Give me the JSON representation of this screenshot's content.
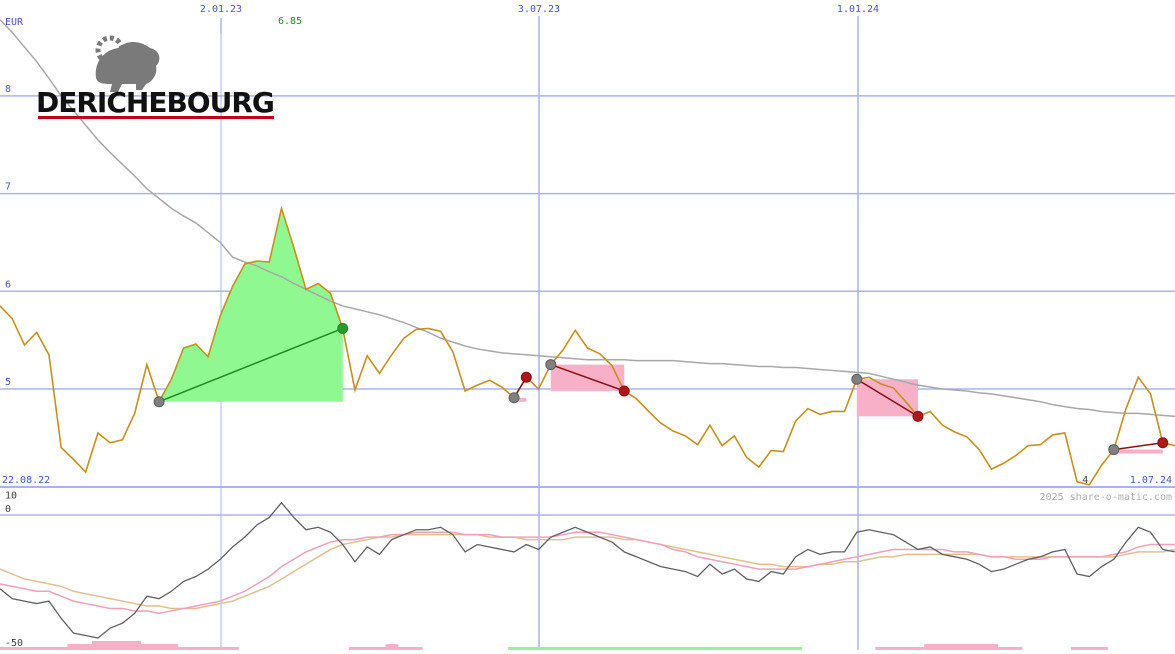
{
  "chart_data": {
    "type": "line",
    "company": "DERICHEBOURG",
    "currency": "EUR",
    "watermark": "2025 share-o-matic.com",
    "x_start_label": "22.08.22",
    "x_date_ticks": [
      "2.01.23",
      "3.07.23",
      "1.01.24"
    ],
    "x_end_label": "1.07.24",
    "y_ticks": [
      8,
      7,
      6,
      5
    ],
    "ylim": [
      3.95,
      9.0
    ],
    "max_label": "6.85",
    "min_label": "4",
    "price_series": [
      5.85,
      5.72,
      5.45,
      5.58,
      5.35,
      4.4,
      4.28,
      4.15,
      4.55,
      4.45,
      4.48,
      4.75,
      5.25,
      4.87,
      5.1,
      5.42,
      5.46,
      5.33,
      5.75,
      6.05,
      6.28,
      6.31,
      6.3,
      6.85,
      6.45,
      6.02,
      6.08,
      5.98,
      5.62,
      4.99,
      5.34,
      5.16,
      5.35,
      5.52,
      5.61,
      5.62,
      5.59,
      5.38,
      4.98,
      5.04,
      5.09,
      5.02,
      4.91,
      5.12,
      5.0,
      5.25,
      5.4,
      5.6,
      5.42,
      5.36,
      5.24,
      4.98,
      4.9,
      4.77,
      4.65,
      4.57,
      4.52,
      4.43,
      4.63,
      4.42,
      4.52,
      4.3,
      4.2,
      4.37,
      4.36,
      4.67,
      4.8,
      4.74,
      4.77,
      4.77,
      5.1,
      5.12,
      5.05,
      5.01,
      4.87,
      4.72,
      4.77,
      4.63,
      4.56,
      4.51,
      4.38,
      4.18,
      4.24,
      4.32,
      4.42,
      4.43,
      4.53,
      4.55,
      4.05,
      4.02,
      4.22,
      4.38,
      4.8,
      5.12,
      4.95,
      4.45,
      4.42
    ],
    "moving_average": [
      8.78,
      8.65,
      8.5,
      8.35,
      8.18,
      8.0,
      7.85,
      7.7,
      7.55,
      7.42,
      7.3,
      7.18,
      7.05,
      6.95,
      6.85,
      6.77,
      6.7,
      6.6,
      6.5,
      6.35,
      6.3,
      6.26,
      6.2,
      6.15,
      6.08,
      6.02,
      5.96,
      5.9,
      5.85,
      5.82,
      5.79,
      5.76,
      5.72,
      5.68,
      5.63,
      5.58,
      5.52,
      5.48,
      5.44,
      5.41,
      5.39,
      5.37,
      5.36,
      5.35,
      5.34,
      5.33,
      5.32,
      5.31,
      5.3,
      5.3,
      5.3,
      5.3,
      5.29,
      5.29,
      5.29,
      5.29,
      5.28,
      5.27,
      5.26,
      5.26,
      5.25,
      5.24,
      5.23,
      5.23,
      5.22,
      5.22,
      5.21,
      5.2,
      5.19,
      5.18,
      5.17,
      5.16,
      5.13,
      5.1,
      5.07,
      5.04,
      5.02,
      5.0,
      4.99,
      4.98,
      4.96,
      4.95,
      4.93,
      4.91,
      4.89,
      4.87,
      4.84,
      4.82,
      4.8,
      4.79,
      4.77,
      4.76,
      4.75,
      4.75,
      4.74,
      4.73,
      4.72
    ],
    "signals": [
      {
        "type": "buy",
        "from": 13,
        "to": 28
      },
      {
        "type": "sell",
        "from": 42,
        "to": 43
      },
      {
        "type": "sell",
        "from": 45,
        "to": 51
      },
      {
        "type": "sell",
        "from": 70,
        "to": 75
      },
      {
        "type": "sell",
        "from": 91,
        "to": 95
      }
    ],
    "oscillator": {
      "ylim": [
        -50,
        10
      ],
      "y_ticks": [
        10,
        0,
        -50
      ],
      "fast": [
        -30,
        -34,
        -35,
        -36,
        -35,
        -42,
        -48,
        -49,
        -50,
        -46,
        -44,
        -40,
        -33,
        -34,
        -31,
        -27,
        -25,
        -22,
        -18,
        -13,
        -9,
        -4,
        -1,
        5,
        -1,
        -6,
        -5,
        -7,
        -12,
        -19,
        -13,
        -16,
        -10,
        -8,
        -6,
        -6,
        -5,
        -8,
        -15,
        -12,
        -13,
        -14,
        -15,
        -12,
        -14,
        -9,
        -7,
        -5,
        -7,
        -9,
        -11,
        -15,
        -17,
        -19,
        -21,
        -22,
        -23,
        -25,
        -20,
        -24,
        -22,
        -26,
        -27,
        -23,
        -24,
        -17,
        -14,
        -16,
        -15,
        -15,
        -7,
        -6,
        -7,
        -8,
        -11,
        -14,
        -13,
        -16,
        -17,
        -18,
        -20,
        -23,
        -22,
        -20,
        -18,
        -17,
        -15,
        -14,
        -24,
        -25,
        -21,
        -18,
        -11,
        -5,
        -7,
        -14,
        -15
      ],
      "slow": [
        -28,
        -29,
        -30,
        -31,
        -31,
        -33,
        -35,
        -36,
        -37,
        -38,
        -38,
        -39,
        -39,
        -40,
        -39,
        -38,
        -37,
        -36,
        -35,
        -33,
        -31,
        -28,
        -25,
        -21,
        -18,
        -15,
        -13,
        -11,
        -10,
        -10,
        -9,
        -9,
        -8,
        -8,
        -7,
        -7,
        -7,
        -7,
        -8,
        -8,
        -8,
        -9,
        -9,
        -9,
        -9,
        -9,
        -8,
        -7,
        -7,
        -7,
        -8,
        -9,
        -10,
        -11,
        -12,
        -14,
        -15,
        -17,
        -18,
        -19,
        -20,
        -21,
        -22,
        -22,
        -22,
        -22,
        -21,
        -20,
        -19,
        -18,
        -17,
        -16,
        -15,
        -14,
        -14,
        -14,
        -14,
        -14,
        -15,
        -15,
        -16,
        -17,
        -17,
        -18,
        -18,
        -18,
        -17,
        -17,
        -17,
        -17,
        -17,
        -16,
        -15,
        -13,
        -12,
        -12,
        -12
      ],
      "slow2": [
        -22,
        -24,
        -26,
        -27,
        -28,
        -29,
        -31,
        -32,
        -33,
        -34,
        -35,
        -36,
        -37,
        -37,
        -38,
        -38,
        -38,
        -37,
        -36,
        -35,
        -33,
        -31,
        -29,
        -26,
        -23,
        -20,
        -17,
        -14,
        -12,
        -11,
        -10,
        -9,
        -9,
        -8,
        -8,
        -8,
        -8,
        -8,
        -8,
        -8,
        -9,
        -9,
        -9,
        -10,
        -10,
        -10,
        -10,
        -9,
        -9,
        -9,
        -9,
        -10,
        -10,
        -11,
        -12,
        -13,
        -14,
        -15,
        -16,
        -17,
        -18,
        -19,
        -20,
        -20,
        -21,
        -21,
        -21,
        -20,
        -20,
        -19,
        -19,
        -18,
        -17,
        -17,
        -16,
        -16,
        -16,
        -16,
        -16,
        -16,
        -16,
        -17,
        -17,
        -17,
        -17,
        -17,
        -17,
        -17,
        -17,
        -17,
        -17,
        -17,
        -16,
        -15,
        -15,
        -15,
        -14
      ]
    },
    "histogram": [
      -1,
      -1,
      -1,
      -1,
      -1,
      -1,
      -2,
      -2,
      -3,
      -3,
      -3,
      -3,
      -2,
      -2,
      -2,
      -1,
      -1,
      -1,
      -1,
      -1,
      0,
      0,
      0,
      0,
      0,
      0,
      0,
      0,
      0,
      -1,
      -1,
      -1,
      -2,
      -1,
      -1,
      0,
      0,
      0,
      0,
      0,
      0,
      0,
      1,
      1,
      1,
      1,
      1,
      1,
      1,
      1,
      1,
      1,
      1,
      1,
      1,
      1,
      1,
      1,
      1,
      1,
      1,
      1,
      1,
      1,
      1,
      1,
      0,
      0,
      0,
      0,
      0,
      0,
      -1,
      -1,
      -1,
      -1,
      -2,
      -2,
      -2,
      -2,
      -2,
      -2,
      -1,
      -1,
      0,
      0,
      0,
      0,
      -1,
      -1,
      -1,
      0,
      0,
      0,
      0,
      0,
      0
    ],
    "colors": {
      "price": "#c8901a",
      "moving_average": "#a8a8a8",
      "grid": "#a8b4f0",
      "axis_text": "#4656c8",
      "buy_fill": "#90f890",
      "sell_fill": "#f8b0c8",
      "buy_line": "#208a20",
      "sell_line": "#8a1010",
      "max_text": "#208a20",
      "oscillator_fast": "#606060",
      "oscillator_slow": "#f0a0b8",
      "oscillator_slow2": "#e0c090",
      "logo_red": "#c0001c",
      "logo_grey": "#7a7a7a"
    }
  }
}
